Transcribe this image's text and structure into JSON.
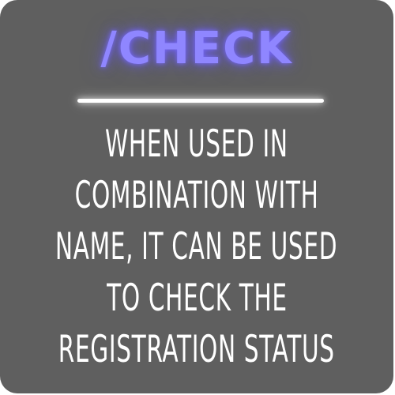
{
  "card": {
    "title": "/CHECK",
    "title_color": "#8f86ff",
    "background_color": "#5f5f5f",
    "description_lines": [
      "WHEN USED IN",
      "COMBINATION WITH",
      "NAME, IT CAN BE USED",
      "TO CHECK THE",
      "REGISTRATION STATUS"
    ]
  }
}
